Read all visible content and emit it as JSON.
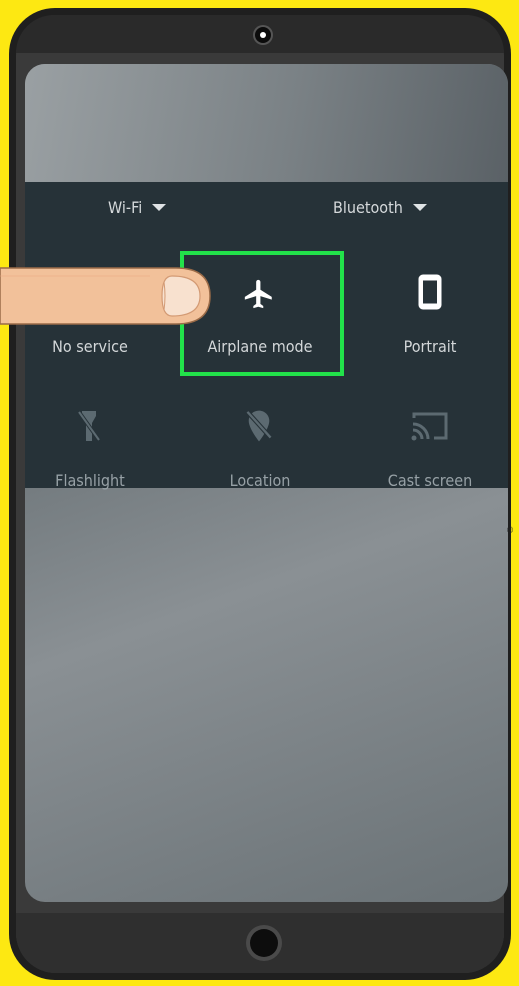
{
  "quick_settings": {
    "wifi_label": "Wi-Fi",
    "bluetooth_label": "Bluetooth",
    "tiles": [
      {
        "label": "No service",
        "icon": "no-service-icon"
      },
      {
        "label": "Airplane mode",
        "icon": "airplane-icon"
      },
      {
        "label": "Portrait",
        "icon": "phone-portrait-icon"
      },
      {
        "label": "Flashlight",
        "icon": "flashlight-off-icon"
      },
      {
        "label": "Location",
        "icon": "location-off-icon"
      },
      {
        "label": "Cast screen",
        "icon": "cast-icon"
      }
    ]
  },
  "overlays": {
    "highlight_color": "#22e24a",
    "pointer": "finger-pointer"
  },
  "colors": {
    "background": "#fde812",
    "panel": "#263238",
    "phone_frame": "#1f1f1f"
  }
}
